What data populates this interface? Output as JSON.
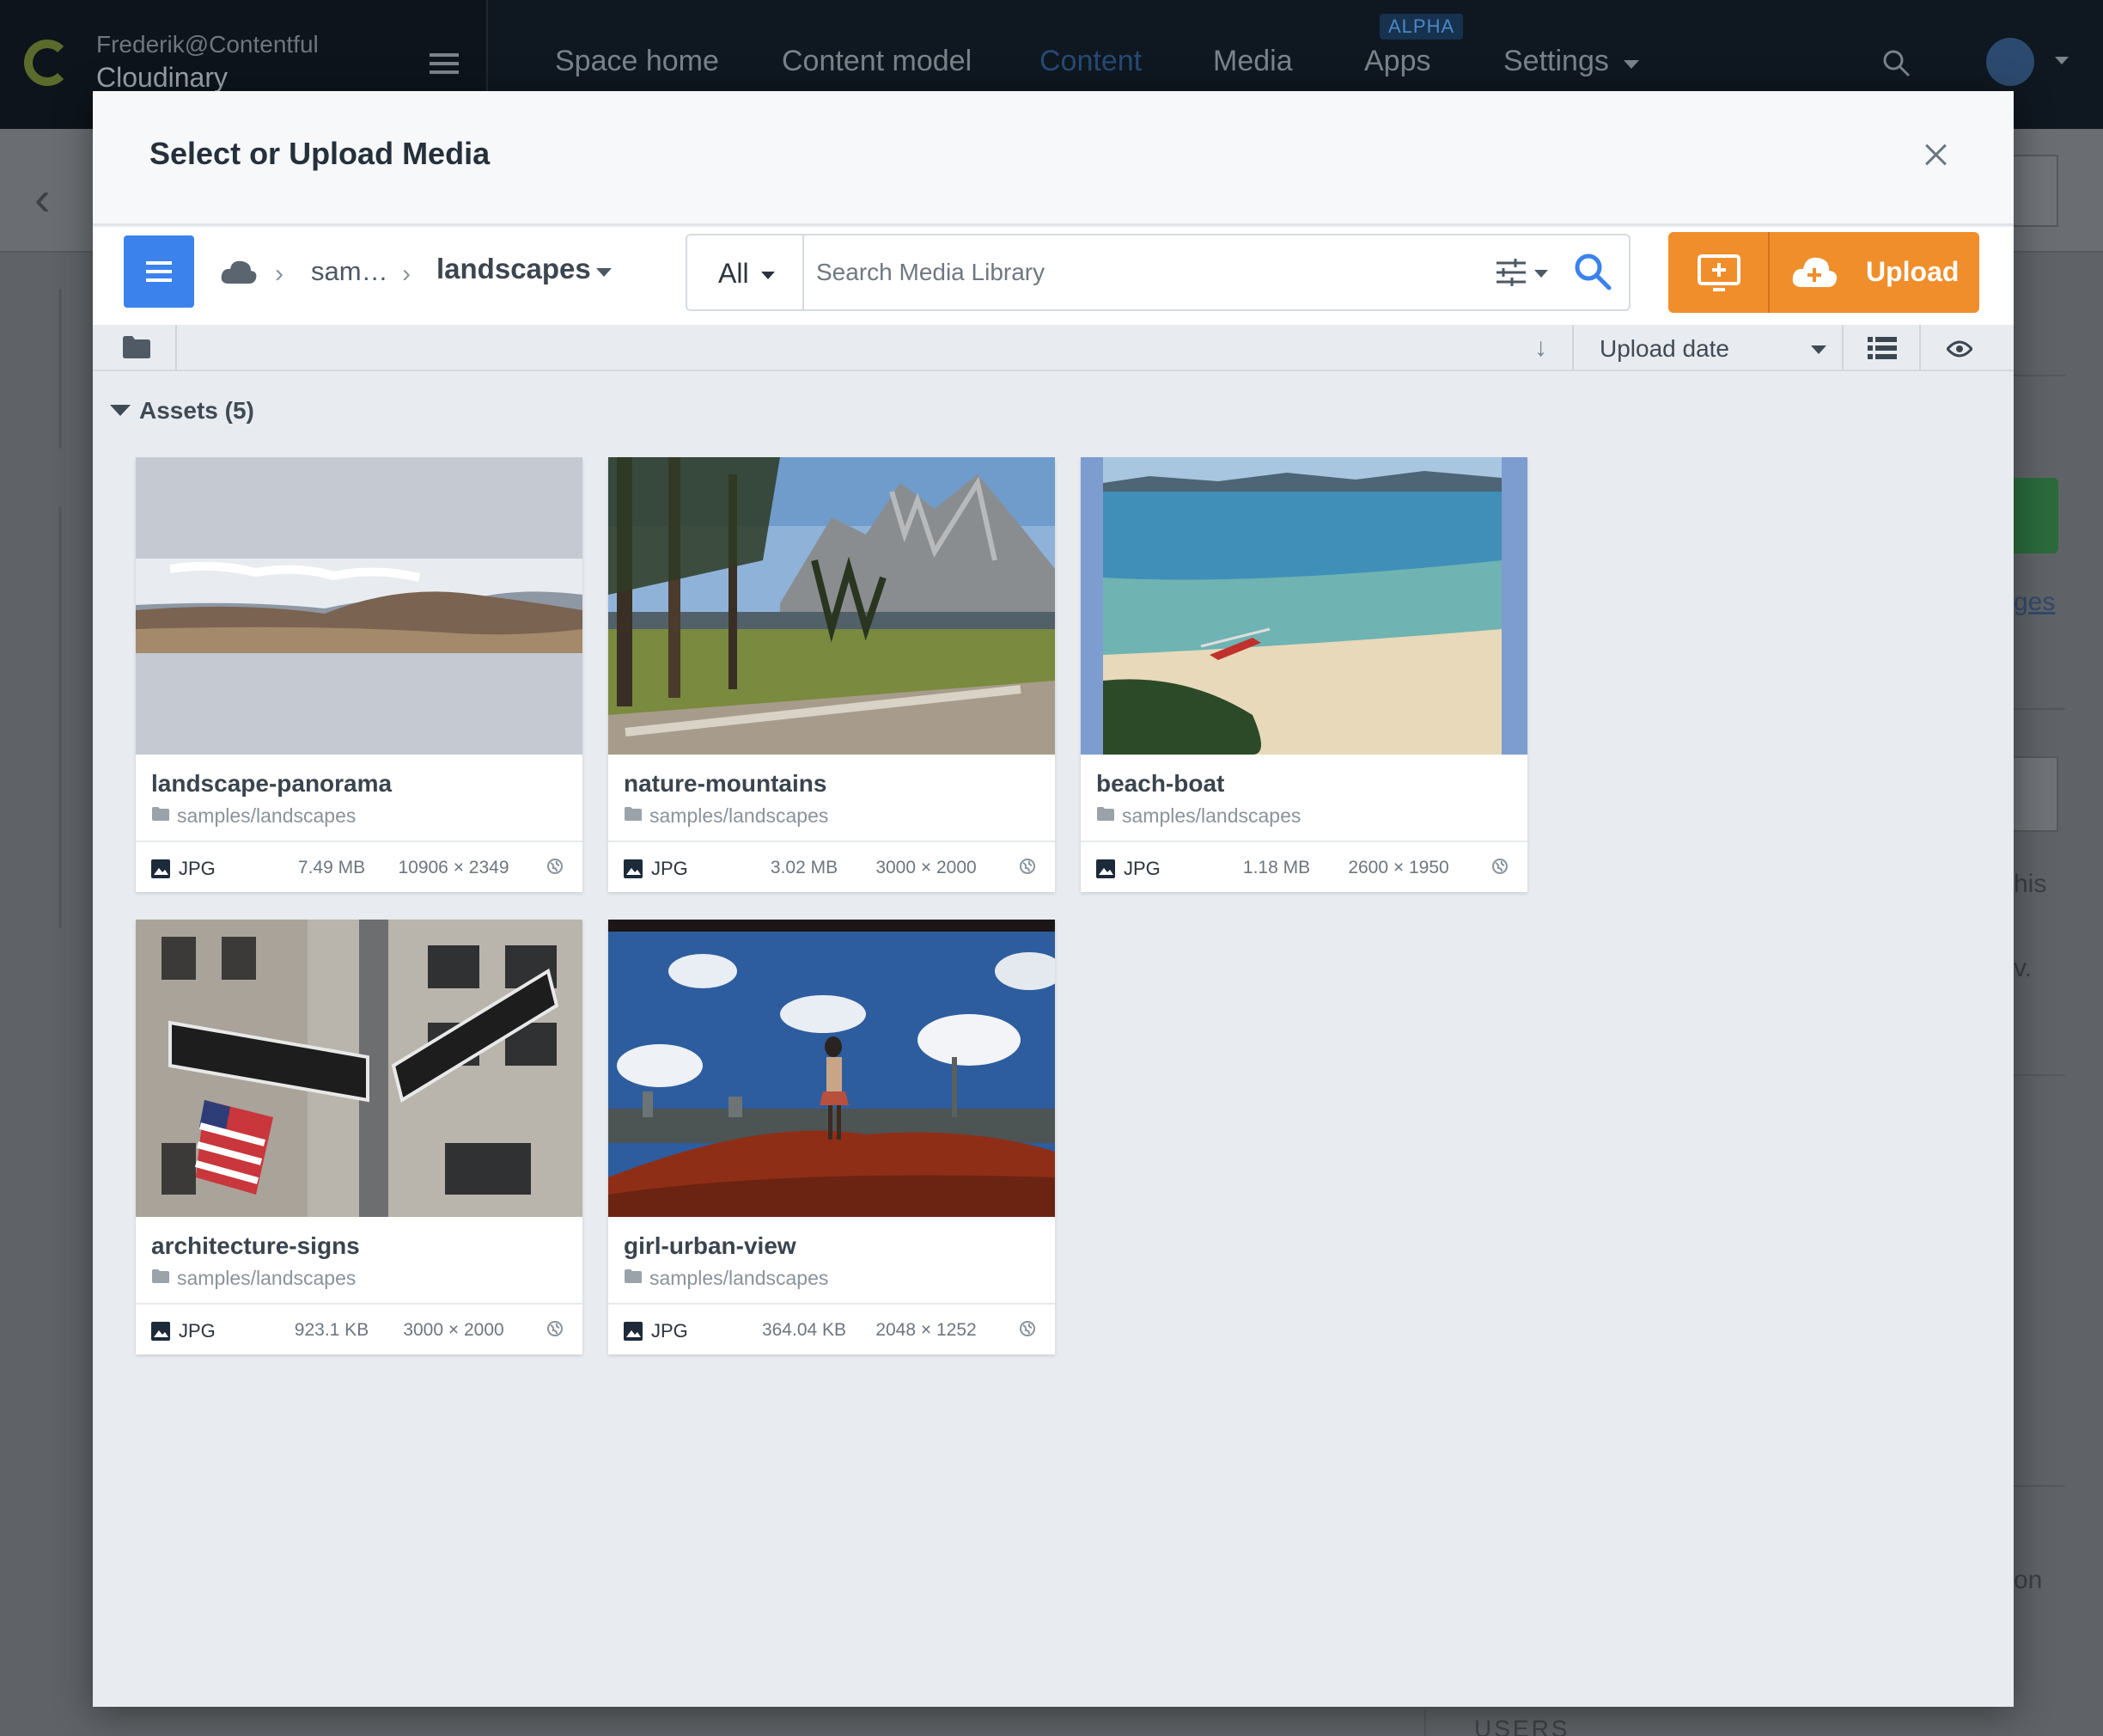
{
  "app": {
    "user": "Frederik@Contentful",
    "space": "Cloudinary",
    "nav": [
      "Space home",
      "Content model",
      "Content",
      "Media",
      "Apps",
      "Settings"
    ],
    "apps_badge": "ALPHA",
    "bg_link_fragment": "ges",
    "bg_text_1": "his",
    "bg_text_2": "v.",
    "bg_text_3": "on",
    "bg_users": "USERS"
  },
  "modal": {
    "title": "Select or Upload Media",
    "breadcrumb": {
      "parent": "sam…",
      "current": "landscapes"
    },
    "search": {
      "scope": "All",
      "placeholder": "Search Media Library"
    },
    "upload_label": "Upload",
    "sort_label": "Upload date",
    "assets_heading": "Assets (5)"
  },
  "assets": [
    {
      "name": "landscape-panorama",
      "path": "samples/landscapes",
      "format": "JPG",
      "size": "7.49 MB",
      "dims": "10906 × 2349"
    },
    {
      "name": "nature-mountains",
      "path": "samples/landscapes",
      "format": "JPG",
      "size": "3.02 MB",
      "dims": "3000 × 2000"
    },
    {
      "name": "beach-boat",
      "path": "samples/landscapes",
      "format": "JPG",
      "size": "1.18 MB",
      "dims": "2600 × 1950"
    },
    {
      "name": "architecture-signs",
      "path": "samples/landscapes",
      "format": "JPG",
      "size": "923.1 KB",
      "dims": "3000 × 2000"
    },
    {
      "name": "girl-urban-view",
      "path": "samples/landscapes",
      "format": "JPG",
      "size": "364.04 KB",
      "dims": "2048 × 1252"
    }
  ],
  "colors": {
    "accent_blue": "#3b82ed",
    "upload_orange": "#f08e2c",
    "topbar": "#0f1720"
  },
  "icons": [
    "menu-icon",
    "cloud-icon",
    "chevron-right-icon",
    "filter-icon",
    "search-icon",
    "upload-media-icon",
    "cloud-upload-icon",
    "folder-icon",
    "sort-arrow-icon",
    "list-view-icon",
    "eye-icon",
    "close-icon",
    "image-icon",
    "globe-icon"
  ]
}
